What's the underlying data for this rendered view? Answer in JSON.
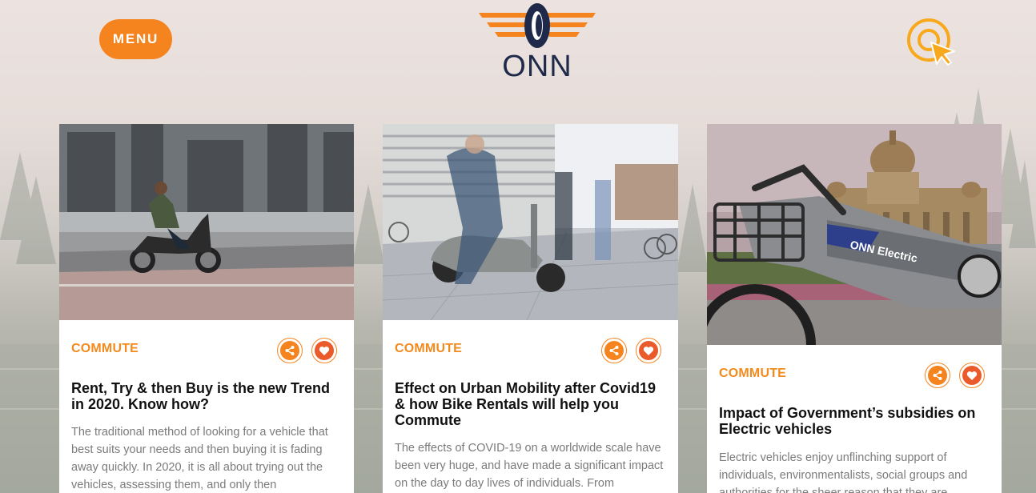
{
  "header": {
    "menu_label": "MENU",
    "logo_text": "ONN",
    "search_icon": "search-cursor-icon"
  },
  "colors": {
    "accent": "#f5841f",
    "heart": "#ea5a2a",
    "logo_navy": "#1f2a4a",
    "category": "#f28a1e"
  },
  "cards": [
    {
      "category": "COMMUTE",
      "title": "Rent, Try & then Buy is the new Trend in 2020. Know how?",
      "excerpt": "The traditional method of looking for a vehicle that best suits your needs and then buying it is fading away quickly. In 2020, it is all about trying out the vehicles, assessing them, and only then",
      "image": "rider-on-electric-scooter-photo",
      "share_icon": "share-icon",
      "like_icon": "heart-icon"
    },
    {
      "category": "COMMUTE",
      "title": "Effect on Urban Mobility after Covid19 & how Bike Rentals will help you Commute",
      "excerpt": "The effects of COVID-19 on a worldwide scale have been very huge, and have made a significant impact on the day to day lives of individuals. From",
      "image": "people-walking-past-scooter-photo",
      "share_icon": "share-icon",
      "like_icon": "heart-icon"
    },
    {
      "category": "COMMUTE",
      "title": "Impact of Government’s subsidies on Electric vehicles",
      "excerpt": "Electric vehicles enjoy unflinching support of individuals, environmentalists, social groups and authorities for the sheer reason that they are",
      "image": "onn-electric-bike-vidhana-soudha-photo",
      "image_caption": "ONN Electric",
      "share_icon": "share-icon",
      "like_icon": "heart-icon"
    }
  ]
}
